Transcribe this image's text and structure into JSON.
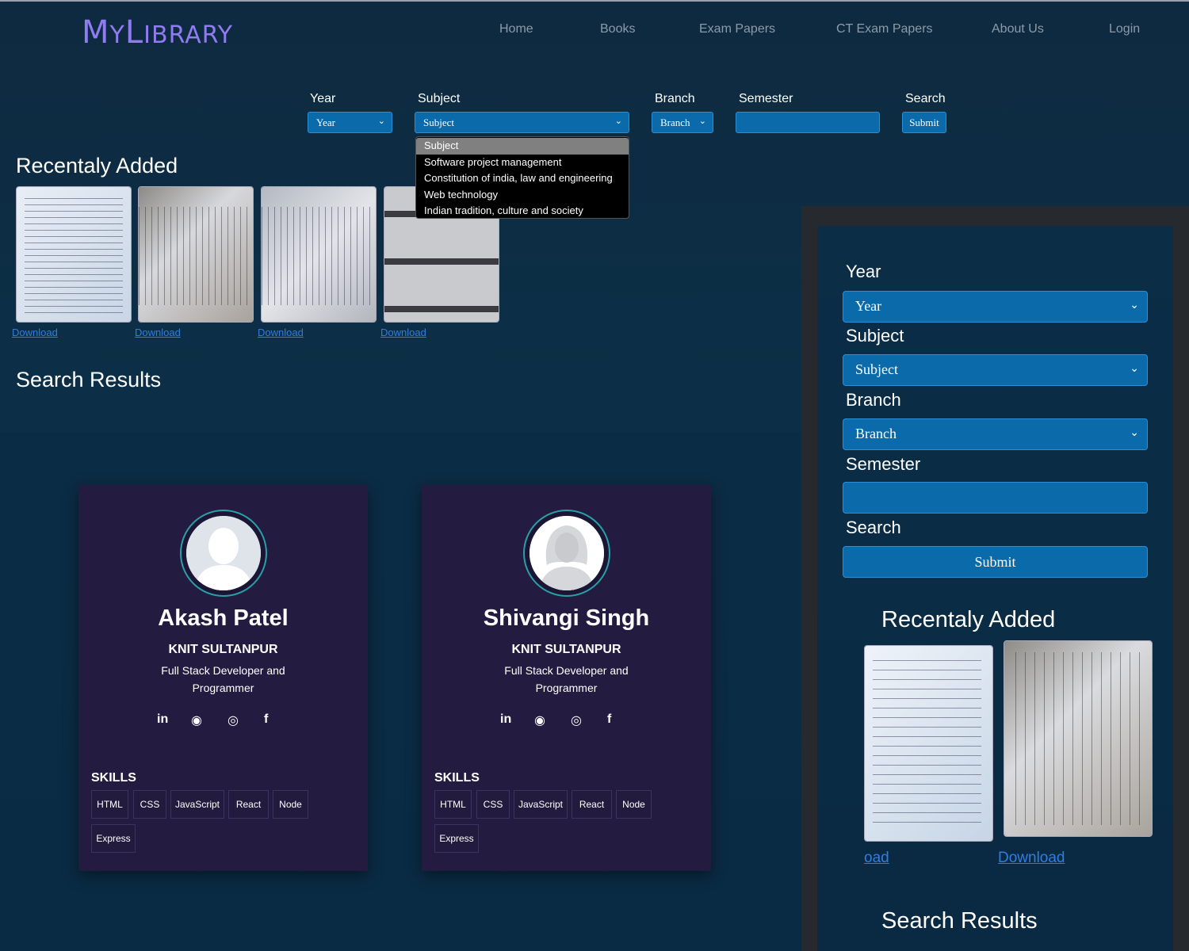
{
  "brand": {
    "logo": "MyLibrary",
    "logo_first": "M",
    "logo_mid": "Y",
    "logo_l": "L",
    "logo_rest": "IBRARY",
    "accent": "#8f7cf0"
  },
  "nav": [
    "Home",
    "Books",
    "Exam Papers",
    "CT Exam Papers",
    "About Us",
    "Login"
  ],
  "filters": {
    "year_label": "Year",
    "year_value": "Year",
    "subject_label": "Subject",
    "subject_value": "Subject",
    "branch_label": "Branch",
    "branch_value": "Branch",
    "semester_label": "Semester",
    "semester_value": "",
    "search_label": "Search",
    "submit_label": "Submit"
  },
  "subject_options": [
    "Subject",
    "Software project management",
    "Constitution of india, law and engineering",
    "Web technology",
    "Indian tradition, culture and society"
  ],
  "recent": {
    "title": "Recentaly Added",
    "download_label": "Download"
  },
  "results": {
    "title": "Search Results"
  },
  "team": [
    {
      "name": "Akash Patel",
      "org": "KNIT SULTANPUR",
      "role": "Full Stack Developer and Programmer",
      "skills_title": "SKILLS",
      "skills": [
        "HTML",
        "CSS",
        "JavaScript",
        "React",
        "Node",
        "Express"
      ]
    },
    {
      "name": "Shivangi Singh",
      "org": "KNIT SULTANPUR",
      "role": "Full Stack Developer and Programmer",
      "skills_title": "SKILLS",
      "skills": [
        "HTML",
        "CSS",
        "JavaScript",
        "React",
        "Node",
        "Express"
      ]
    }
  ],
  "socials": [
    "linkedin-icon",
    "github-icon",
    "instagram-icon",
    "facebook-icon"
  ],
  "mobile": {
    "year_label": "Year",
    "year_value": "Year",
    "subject_label": "Subject",
    "subject_value": "Subject",
    "branch_label": "Branch",
    "branch_value": "Branch",
    "semester_label": "Semester",
    "semester_value": "",
    "search_label": "Search",
    "submit_label": "Submit",
    "recent_title": "Recentaly Added",
    "download_partial": "oad",
    "download_label": "Download",
    "results_title": "Search Results"
  }
}
